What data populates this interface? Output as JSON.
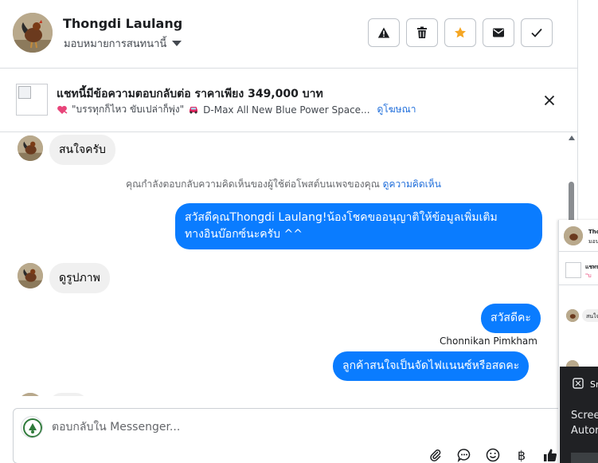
{
  "header": {
    "name": "Thongdi Laulang",
    "assign_label": "มอบหมายการสนทนานี้",
    "actions": [
      "report-spam",
      "delete",
      "star",
      "mark-unread",
      "mark-done"
    ],
    "star_color": "#f5a623"
  },
  "ad": {
    "title": "แชทนี้มีข้อความตอบกลับต่อ ราคาเพียง 349,000 บาท",
    "snippet": "\"บรรทุกก็ไหว ขับเปล่าก็พุ่ง\"",
    "car_text": "D-Max All New Blue Power Space...",
    "link": "ดูโฆษณา"
  },
  "messages": {
    "m1": "สนใจครับ",
    "notice_text": "คุณกำลังตอบกลับความคิดเห็นของผู้ใช้ต่อโพสต์บนเพจของคุณ",
    "notice_link": "ดูความคิดเห็น",
    "m2_line1": "สวัสดีคุณThongdi Laulang!น้องโชคขออนุญาติให้ข้อมูลเพิ่มเติม",
    "m2_line2": "ทางอินบ๊อกซ์นะครับ ^^",
    "m3": "ดูรูปภาพ",
    "m4": "สวัสดีคะ",
    "sender": "Chonnikan Pimkham",
    "m5": "ลูกค้าสนใจเป็นจัดไฟแนนซ์หรือสดคะ"
  },
  "composer": {
    "placeholder": "ตอบกลับใน Messenger..."
  },
  "mini_panel": {
    "name": "Thon",
    "sub": "มอบ",
    "ad": "แชทน",
    "ad2": "\"บ",
    "msg": "สนใจ"
  },
  "toast": {
    "title": "Sn",
    "body_line1": "Scree",
    "body_line2": "Autor"
  },
  "colors": {
    "outgoing_bubble": "#0a7cff",
    "incoming_bubble": "#f0f0f0",
    "link": "#216fdb"
  }
}
